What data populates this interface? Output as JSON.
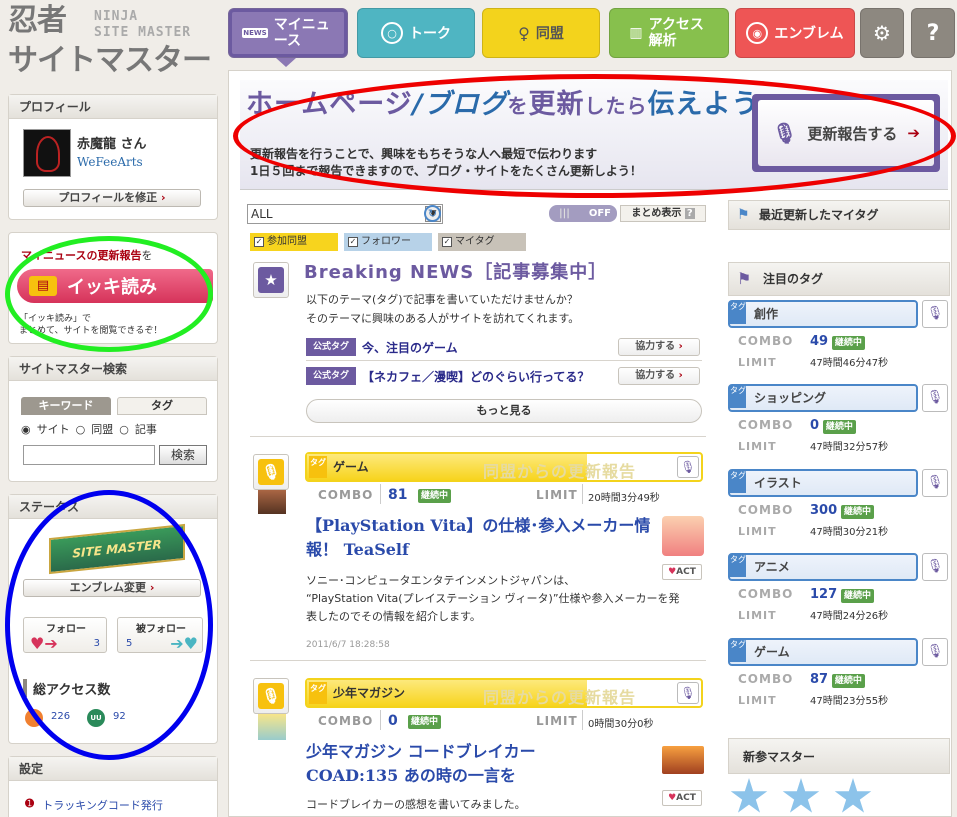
{
  "logo": {
    "jp_line1": "忍者",
    "jp_line2": "サイトマスター",
    "en_line1": "NINJA",
    "en_line2": "SITE MASTER"
  },
  "tabs": {
    "news": {
      "small": "NEWS",
      "label": "マイニュース"
    },
    "talk": {
      "label": "トーク"
    },
    "doumei": {
      "label": "同盟"
    },
    "access": {
      "label": "アクセス解析"
    },
    "emblem": {
      "label": "エンブレム"
    },
    "gear_icon": "⚙",
    "help": "?"
  },
  "profile": {
    "title": "プロフィール",
    "name": "赤魔龍 さん",
    "site": "WeFeeArts",
    "edit_button": "プロフィールを修正"
  },
  "ikki": {
    "heading": "マイニュースの更新報告",
    "heading_suffix": "を",
    "button": "イッキ読み",
    "desc_line1": "「イッキ読み」で",
    "desc_line2": "まとめて、サイトを閲覧できるぞ！"
  },
  "search": {
    "title": "サイトマスター検索",
    "tab_keyword": "キーワード",
    "tab_tag": "タグ",
    "opt_site": "サイト",
    "opt_doumei": "同盟",
    "opt_kiji": "記事",
    "button": "検索"
  },
  "status": {
    "title": "ステータス",
    "emblem_text": "SITE MASTER",
    "emblem_change": "エンブレム変更",
    "follow_label": "フォロー",
    "follow_count": "3",
    "follower_label": "被フォロー",
    "follower_count": "5",
    "access_title": "総アクセス数",
    "access1": "226",
    "access2": "92",
    "access2_icon": "UU"
  },
  "settings": {
    "title": "設定",
    "link": "トラッキングコード発行"
  },
  "banner": {
    "title_a": "ホームページ",
    "title_b": "/ブログ",
    "title_c": "を",
    "title_d": "更新",
    "title_e": "したら",
    "title_f": "伝えよう",
    "sub1": "更新報告を行うことで、興味をもちそうな人へ最短で伝わります",
    "sub2": "1日５回まで報告できますので、ブログ・サイトをたくさん更新しよう！",
    "button": "更新報告する"
  },
  "filter": {
    "selected": "ALL",
    "toggle": "OFF",
    "summary": "まとめ表示",
    "chip1": "参加同盟",
    "chip2": "フォロワー",
    "chip3": "マイタグ"
  },
  "breaking": {
    "title": "Breaking NEWS［記事募集中］",
    "desc1": "以下のテーマ(タグ)で記事を書いていただけませんか？",
    "desc2": "そのテーマに興味のある人がサイトを訪れてくれます。",
    "official_label": "公式タグ",
    "topic1": "今、注目のゲーム",
    "topic2": "【ネカフェ／漫喫】どのぐらい行ってる？",
    "help_btn": "協力する",
    "more": "もっと見る"
  },
  "articles": [
    {
      "tag": "ゲーム",
      "tag_label": "タグ",
      "wm": "同盟からの更新報告",
      "combo_label": "COMBO",
      "combo": "81",
      "status": "継続中",
      "limit_label": "LIMIT",
      "limit": "20時間3分49秒",
      "title1": "【PlayStation Vita】の仕様･参入メーカー情",
      "title2": "報！ TeaSelf",
      "body1": "ソニー･コンピュータエンタテインメントジャパンは、",
      "body2": "“PlayStation Vita(プレイステーション ヴィータ)”仕様や参入メーカーを発",
      "body3": "表したのでその情報を紹介します。",
      "date": "2011/6/7 18:28:58",
      "act": "ACT"
    },
    {
      "tag": "少年マガジン",
      "tag_label": "タグ",
      "wm": "同盟からの更新報告",
      "combo_label": "COMBO",
      "combo": "0",
      "status": "継続中",
      "limit_label": "LIMIT",
      "limit": "0時間30分0秒",
      "title1": "少年マガジン コードブレイカー",
      "title2": "COAD:135 あの時の一言を",
      "body1": "コードブレイカーの感想を書いてみました。",
      "act": "ACT"
    }
  ],
  "right": {
    "recent_title": "最近更新したマイタグ",
    "hot_title": "注目のタグ",
    "tags": [
      {
        "name": "創作",
        "combo": "49",
        "limit": "47時間46分47秒"
      },
      {
        "name": "ショッピング",
        "combo": "0",
        "limit": "47時間32分57秒"
      },
      {
        "name": "イラスト",
        "combo": "300",
        "limit": "47時間30分21秒"
      },
      {
        "name": "アニメ",
        "combo": "127",
        "limit": "47時間24分26秒"
      },
      {
        "name": "ゲーム",
        "combo": "87",
        "limit": "47時間23分55秒"
      }
    ],
    "combo_label": "COMBO",
    "limit_label": "LIMIT",
    "status": "継続中",
    "tag_label": "タグ",
    "new_masters": "新参マスター"
  },
  "colors": {
    "purple": "#6c5aa0",
    "red_oval": "#ee0000",
    "green_oval": "#22ee22",
    "blue_oval": "#0000ee"
  }
}
